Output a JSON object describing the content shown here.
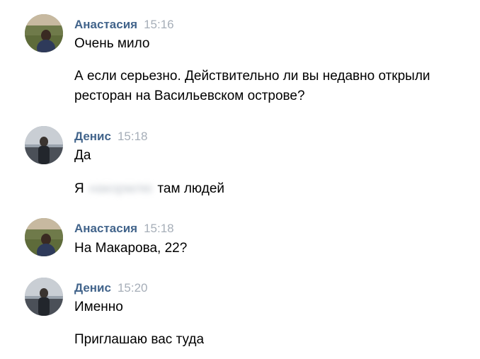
{
  "messages": [
    {
      "author": "Анастасия",
      "time": "15:16",
      "lines": [
        "Очень мило",
        "А если серьезно. Действительно ли вы недавно открыли ресторан на Васильевском острове?"
      ]
    },
    {
      "author": "Денис",
      "time": "15:18",
      "lines": [
        "Да"
      ],
      "censored_line": {
        "before": "Я",
        "blurred": "накормлю",
        "after": "там людей"
      }
    },
    {
      "author": "Анастасия",
      "time": "15:18",
      "lines": [
        "На Макарова, 22?"
      ]
    },
    {
      "author": "Денис",
      "time": "15:20",
      "lines": [
        "Именно",
        "Приглашаю вас туда"
      ]
    }
  ],
  "colors": {
    "author_name": "#42648b",
    "timestamp": "#a6aeb8",
    "message_text": "#000000",
    "background": "#ffffff"
  }
}
